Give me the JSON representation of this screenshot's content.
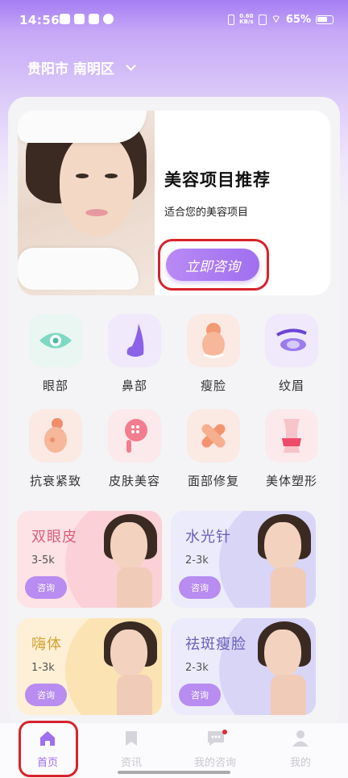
{
  "status_bar": {
    "time": "14:56",
    "net_speed_value": "0.60",
    "net_speed_unit": "KB/s",
    "battery": "65%"
  },
  "location": {
    "text": "贵阳市 南明区"
  },
  "banner": {
    "title": "美容项目推荐",
    "subtitle": "适合您的美容项目",
    "button_label": "立即咨询"
  },
  "categories": [
    {
      "label": "眼部",
      "icon": "eye-icon",
      "bg": "#e9f6f2"
    },
    {
      "label": "鼻部",
      "icon": "nose-icon",
      "bg": "#efe9fb"
    },
    {
      "label": "瘦脸",
      "icon": "face-slim-icon",
      "bg": "#fbe9e4"
    },
    {
      "label": "纹眉",
      "icon": "eyebrow-icon",
      "bg": "#efe9fb"
    },
    {
      "label": "抗衰紧致",
      "icon": "anti-aging-icon",
      "bg": "#fbe9e4"
    },
    {
      "label": "皮肤美容",
      "icon": "skin-care-icon",
      "bg": "#fbe9ec"
    },
    {
      "label": "面部修复",
      "icon": "face-repair-icon",
      "bg": "#fbe9e4"
    },
    {
      "label": "美体塑形",
      "icon": "body-shaping-icon",
      "bg": "#fbe9ec"
    }
  ],
  "services": [
    {
      "name": "双眼皮",
      "price": "3-5k",
      "button": "咨询",
      "color": "#d9607a",
      "bg": "#fde2e6",
      "accent": "#fbd0d7"
    },
    {
      "name": "水光针",
      "price": "2-3k",
      "button": "咨询",
      "color": "#6a5fb8",
      "bg": "#ecebfb",
      "accent": "#d8d5f7"
    },
    {
      "name": "嗨体",
      "price": "1-3k",
      "button": "咨询",
      "color": "#d4a235",
      "bg": "#fdf0d6",
      "accent": "#fbe3b4"
    },
    {
      "name": "祛斑瘦脸",
      "price": "2-3k",
      "button": "咨询",
      "color": "#6a5fb8",
      "bg": "#ecebfb",
      "accent": "#d8d5f7"
    }
  ],
  "tabbar": [
    {
      "label": "首页",
      "icon": "home-icon",
      "active": true
    },
    {
      "label": "资讯",
      "icon": "bookmark-icon",
      "active": false
    },
    {
      "label": "我的咨询",
      "icon": "chat-icon",
      "active": false
    },
    {
      "label": "我的",
      "icon": "user-icon",
      "active": false
    }
  ],
  "colors": {
    "accent": "#a06ff0",
    "highlight_ring": "#d6232c"
  }
}
